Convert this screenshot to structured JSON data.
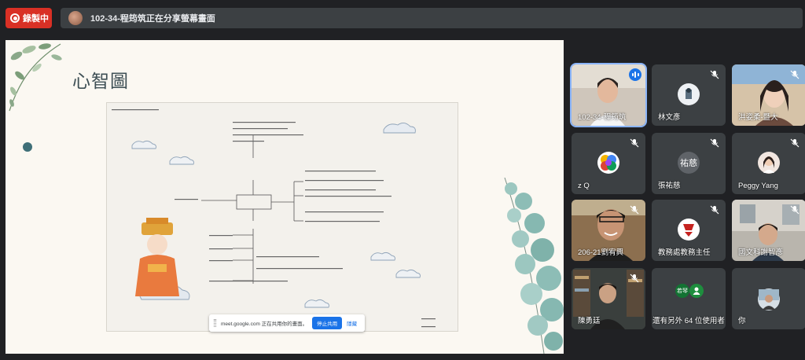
{
  "recording": {
    "label": "錄製中"
  },
  "presenter_bar": {
    "text": "102-34-程筠筑正在分享螢幕畫面"
  },
  "slide": {
    "title": "心智圖"
  },
  "share_notice": {
    "text": "meet.google.com 正在共用你的畫面。",
    "stop_label": "停止共用",
    "hide_label": "隱藏"
  },
  "participants": [
    {
      "name": "102-34-程筠筑",
      "status": "speaking",
      "type": "video"
    },
    {
      "name": "林文彥",
      "status": "muted",
      "type": "avatar"
    },
    {
      "name": "洪姿柔-暨大",
      "status": "muted",
      "type": "video"
    },
    {
      "name": "z Q",
      "status": "muted",
      "type": "avatar"
    },
    {
      "name": "張祐慈",
      "status": "muted",
      "type": "avatar",
      "initials": "祐慈"
    },
    {
      "name": "Peggy Yang",
      "status": "muted",
      "type": "avatar"
    },
    {
      "name": "206-21劉宥興",
      "status": "muted",
      "type": "video"
    },
    {
      "name": "教務處教務主任",
      "status": "muted",
      "type": "avatar"
    },
    {
      "name": "國文科謝智彥",
      "status": "muted",
      "type": "video"
    },
    {
      "name": "陳勇廷",
      "status": "muted",
      "type": "video"
    },
    {
      "name": "還有另外 64 位使用者",
      "status": "",
      "type": "group",
      "initials": "若琴"
    },
    {
      "name": "你",
      "status": "",
      "type": "avatar"
    }
  ],
  "colors": {
    "record_red": "#d93025",
    "accent_blue": "#1a73e8",
    "tile_bg": "#3c4043",
    "meet_bg": "#202124"
  }
}
